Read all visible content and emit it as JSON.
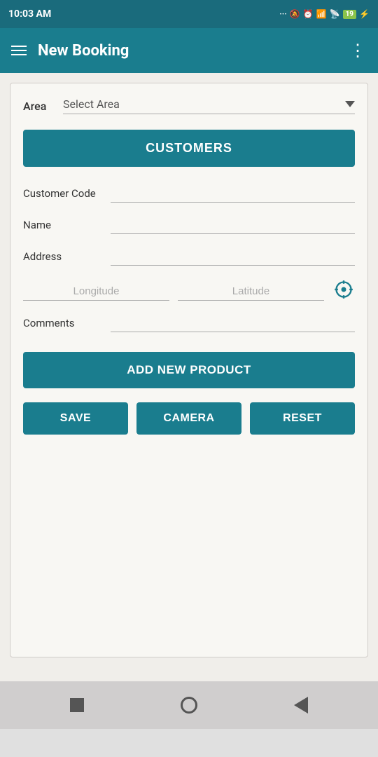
{
  "status_bar": {
    "time": "10:03 AM",
    "battery_level": "19",
    "icons": [
      "signal-dots",
      "vibrate-icon",
      "alarm-icon",
      "signal-bars-icon",
      "wifi-icon",
      "battery-icon",
      "charging-icon"
    ]
  },
  "app_bar": {
    "title": "New Booking",
    "menu_label": "Menu",
    "more_label": "More options"
  },
  "form": {
    "area_label": "Area",
    "area_placeholder": "Select Area",
    "customers_button": "CUSTOMERS",
    "customer_code_label": "Customer Code",
    "customer_code_value": "",
    "name_label": "Name",
    "name_value": "",
    "address_label": "Address",
    "address_value": "",
    "longitude_placeholder": "Longitude",
    "latitude_placeholder": "Latitude",
    "comments_label": "Comments",
    "comments_value": "",
    "add_product_button": "ADD NEW PRODUCT",
    "save_button": "SAVE",
    "camera_button": "CAMERA",
    "reset_button": "RESET"
  },
  "nav": {
    "back_label": "Back",
    "home_label": "Home",
    "recent_label": "Recent"
  }
}
